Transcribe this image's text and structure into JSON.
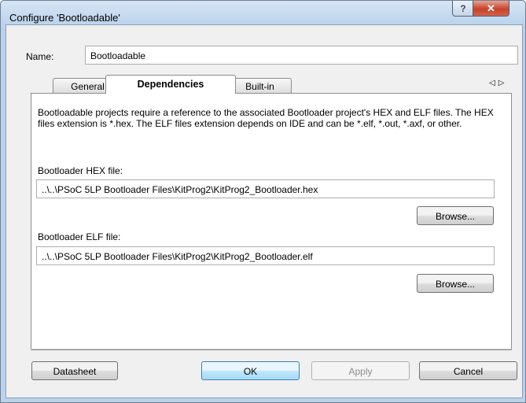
{
  "window": {
    "title": "Configure 'Bootloadable'",
    "help_glyph": "?",
    "close_glyph": "✕"
  },
  "name": {
    "label": "Name:",
    "value": "Bootloadable"
  },
  "tabs": [
    {
      "label": "General"
    },
    {
      "label": "Dependencies",
      "selected": true
    },
    {
      "label": "Built-in"
    }
  ],
  "tab_scroll": {
    "left": "◁",
    "right": "▷"
  },
  "dependencies": {
    "description": "Bootloadable projects require a reference to the associated Bootloader project's HEX and ELF files. The HEX files extension is *.hex. The ELF files extension depends on IDE and can be *.elf, *.out, *.axf, or other.",
    "hex_label": "Bootloader HEX file:",
    "hex_value": "..\\..\\PSoC 5LP Bootloader Files\\KitProg2\\KitProg2_Bootloader.hex",
    "hex_browse": "Browse...",
    "elf_label": "Bootloader ELF file:",
    "elf_value": "..\\..\\PSoC 5LP Bootloader Files\\KitProg2\\KitProg2_Bootloader.elf",
    "elf_browse": "Browse..."
  },
  "buttons": {
    "datasheet": "Datasheet",
    "ok": "OK",
    "apply": "Apply",
    "cancel": "Cancel"
  }
}
